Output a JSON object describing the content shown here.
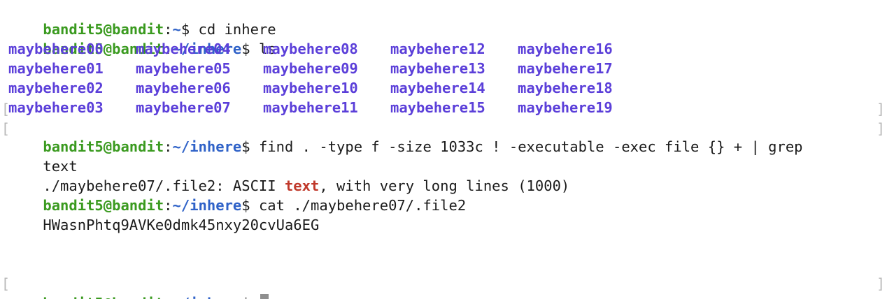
{
  "prompt": {
    "user_host": "bandit5@bandit",
    "sep": ":",
    "home": "~",
    "inhere_path": "~/inhere",
    "dollar": "$"
  },
  "commands": {
    "cd": " cd inhere",
    "ls": " ls",
    "find": " find . -type f -size 1033c ! -executable -exec file {} + | grep",
    "find_wrap": "text",
    "cat": " cat ./maybehere07/.file2"
  },
  "ls_output": [
    [
      "maybehere00",
      "maybehere04",
      "maybehere08",
      "maybehere12",
      "maybehere16"
    ],
    [
      "maybehere01",
      "maybehere05",
      "maybehere09",
      "maybehere13",
      "maybehere17"
    ],
    [
      "maybehere02",
      "maybehere06",
      "maybehere10",
      "maybehere14",
      "maybehere18"
    ],
    [
      "maybehere03",
      "maybehere07",
      "maybehere11",
      "maybehere15",
      "maybehere19"
    ]
  ],
  "grep_result": {
    "before": "./maybehere07/.file2: ASCII ",
    "match": "text",
    "after": ", with very long lines (1000)"
  },
  "password": "HWasnPhtq9AVKe0dmk45nxy20cvUa6EG",
  "brackets": {
    "left": "[",
    "right": "]"
  },
  "colors": {
    "prompt_user": "#3a9a1f",
    "prompt_path": "#2f62c8",
    "directory": "#5b3fd9",
    "grep_match": "#c0392b",
    "cursor": "#8f8f8f"
  }
}
